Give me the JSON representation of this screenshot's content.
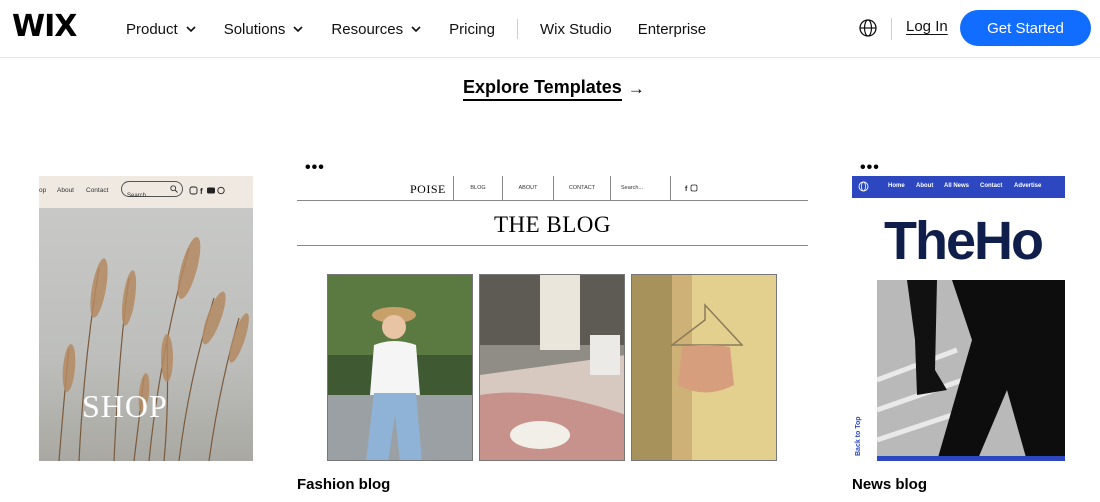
{
  "header": {
    "logo": "WIX",
    "nav": [
      {
        "label": "Product",
        "dropdown": true
      },
      {
        "label": "Solutions",
        "dropdown": true
      },
      {
        "label": "Resources",
        "dropdown": true
      },
      {
        "label": "Pricing",
        "dropdown": false
      },
      {
        "label": "Wix Studio",
        "dropdown": false
      },
      {
        "label": "Enterprise",
        "dropdown": false
      }
    ],
    "language_icon": "globe-icon",
    "login_label": "Log In",
    "cta_label": "Get Started",
    "cta_color": "#116dff"
  },
  "explore": {
    "label": "Explore Templates",
    "arrow": "→"
  },
  "cards": {
    "shop": {
      "nav": {
        "item1": "op",
        "item2": "About",
        "item3": "Contact"
      },
      "search_placeholder": "Search...",
      "hero_text": "SHOP"
    },
    "blog": {
      "more": "•••",
      "brand": "POISE",
      "nav": {
        "blog": "BLOG",
        "about": "ABOUT",
        "contact": "CONTACT",
        "search": "Search..."
      },
      "title": "THE BLOG",
      "caption": "Fashion blog"
    },
    "news": {
      "more": "•••",
      "nav": {
        "home": "Home",
        "about": "About",
        "all_news": "All News",
        "contact": "Contact",
        "advertise": "Advertise"
      },
      "headline": "TheHo",
      "back_to_top": "Back to Top",
      "caption": "News blog",
      "accent_color": "#2d47c0"
    }
  }
}
